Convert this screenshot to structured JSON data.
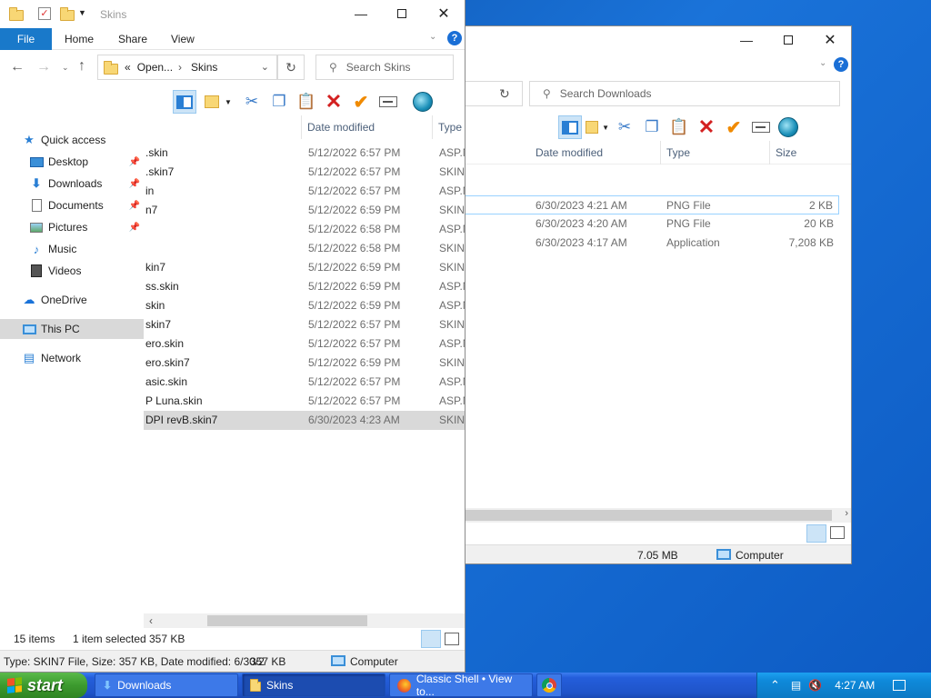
{
  "downloads_window": {
    "search_placeholder": "Search Downloads",
    "columns": {
      "date_modified": "Date modified",
      "type": "Type",
      "size": "Size"
    },
    "rows": [
      {
        "date": "6/30/2023 4:21 AM",
        "type": "PNG File",
        "size": "2 KB"
      },
      {
        "date": "6/30/2023 4:20 AM",
        "type": "PNG File",
        "size": "20 KB"
      },
      {
        "date": "6/30/2023 4:17 AM",
        "type": "Application",
        "size": "7,208 KB"
      }
    ],
    "status": {
      "size": "7.05 MB",
      "location": "Computer"
    }
  },
  "skins_window": {
    "title": "Skins",
    "ribbon_tabs": [
      "File",
      "Home",
      "Share",
      "View"
    ],
    "address": {
      "prefix": "«",
      "part1": "Open...",
      "separator": "›",
      "part2": "Skins"
    },
    "search_placeholder": "Search Skins",
    "columns": {
      "date_modified": "Date modified",
      "type": "Type"
    },
    "nav": {
      "quick_access": "Quick access",
      "desktop": "Desktop",
      "downloads": "Downloads",
      "documents": "Documents",
      "pictures": "Pictures",
      "music": "Music",
      "videos": "Videos",
      "onedrive": "OneDrive",
      "this_pc": "This PC",
      "network": "Network"
    },
    "files": [
      {
        "name": ".skin",
        "date": "5/12/2022 6:57 PM",
        "type": "ASP.N"
      },
      {
        "name": ".skin7",
        "date": "5/12/2022 6:57 PM",
        "type": "SKIN7"
      },
      {
        "name": "in",
        "date": "5/12/2022 6:57 PM",
        "type": "ASP.N"
      },
      {
        "name": "n7",
        "date": "5/12/2022 6:59 PM",
        "type": "SKIN7"
      },
      {
        "name": "",
        "date": "5/12/2022 6:58 PM",
        "type": "ASP.N"
      },
      {
        "name": "",
        "date": "5/12/2022 6:58 PM",
        "type": "SKIN7"
      },
      {
        "name": "kin7",
        "date": "5/12/2022 6:59 PM",
        "type": "SKIN7"
      },
      {
        "name": "ss.skin",
        "date": "5/12/2022 6:59 PM",
        "type": "ASP.N"
      },
      {
        "name": "skin",
        "date": "5/12/2022 6:59 PM",
        "type": "ASP.N"
      },
      {
        "name": "skin7",
        "date": "5/12/2022 6:57 PM",
        "type": "SKIN7"
      },
      {
        "name": "ero.skin",
        "date": "5/12/2022 6:57 PM",
        "type": "ASP.N"
      },
      {
        "name": "ero.skin7",
        "date": "5/12/2022 6:59 PM",
        "type": "SKIN7"
      },
      {
        "name": "asic.skin",
        "date": "5/12/2022 6:57 PM",
        "type": "ASP.N"
      },
      {
        "name": "P Luna.skin",
        "date": "5/12/2022 6:57 PM",
        "type": "ASP.N"
      },
      {
        "name": "DPI revB.skin7",
        "date": "6/30/2023 4:23 AM",
        "type": "SKIN7"
      }
    ],
    "status": {
      "items": "15 items",
      "selected": "1 item selected",
      "size": "357 KB"
    },
    "details_bar": {
      "text": "Type: SKIN7 File, Size: 357 KB, Date modified: 6/30/2",
      "size": "357 KB",
      "location": "Computer"
    }
  },
  "taskbar": {
    "start_label": "start",
    "tasks": [
      "Downloads",
      "Skins",
      "Classic Shell • View to..."
    ],
    "clock": "4:27 AM"
  },
  "colors": {
    "accent": "#1979ca",
    "selection": "#cce8ff",
    "taskbar": "#245edb",
    "start": "#3c9a2e"
  }
}
